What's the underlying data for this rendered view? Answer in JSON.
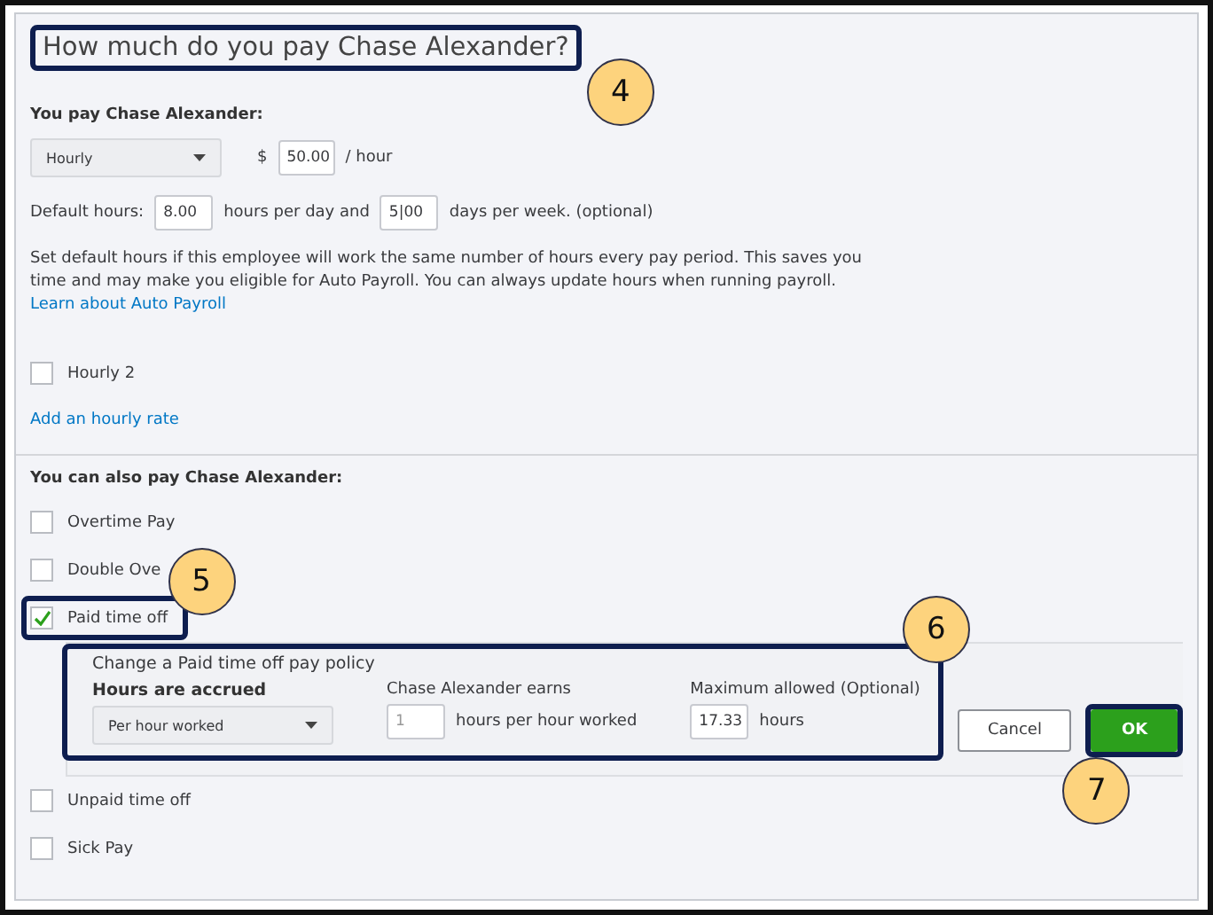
{
  "title": {
    "text": "How much do you pay Chase Alexander?",
    "callout": "4"
  },
  "pay": {
    "heading": "You pay Chase Alexander:",
    "pay_type": "Hourly",
    "currency": "$",
    "rate": "50.00",
    "unit": "/ hour"
  },
  "default_hours": {
    "label": "Default hours:",
    "hours_per_day": "8.00",
    "between": "hours per day and",
    "days_per_week": "5|00",
    "after": "days per week. (optional)"
  },
  "note": {
    "text": "Set default hours if this employee will work the same number of hours every pay period. This saves you time and may make you eligible for Auto Payroll. You can always update hours when running payroll.",
    "link": "Learn about Auto Payroll"
  },
  "rates": [
    {
      "label": "Hourly 2",
      "checked": false
    }
  ],
  "add_rate_link": "Add an hourly rate",
  "also_pay": {
    "heading": "You can also pay Chase Alexander:",
    "items": [
      {
        "label": "Overtime Pay",
        "checked": false
      },
      {
        "label": "Double Ove",
        "checked": false
      },
      {
        "label": "Paid time off",
        "checked": true,
        "callout": "5",
        "policy": {
          "title": "Change a Paid time off pay policy",
          "callout": "6",
          "accrual_label": "Hours are accrued",
          "accrual": "Per hour worked",
          "earns_label": "Chase Alexander earns",
          "earns": "1",
          "earns_unit": "hours per hour worked",
          "max_label": "Maximum allowed (Optional)",
          "max": "17.33",
          "max_unit": "hours",
          "cancel": "Cancel",
          "ok": "OK",
          "ok_callout": "7"
        }
      },
      {
        "label": "Unpaid time off",
        "checked": false
      },
      {
        "label": "Sick Pay",
        "checked": false
      }
    ]
  }
}
